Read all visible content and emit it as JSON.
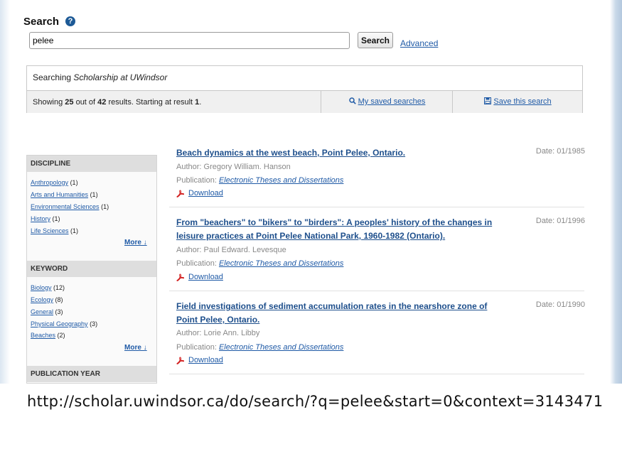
{
  "search": {
    "title": "Search",
    "help_icon": "help-icon",
    "query_value": "pelee",
    "button_label": "Search",
    "advanced_label": "Advanced"
  },
  "scope": {
    "prefix": "Searching ",
    "collection": "Scholarship at UWindsor"
  },
  "status": {
    "showing_label": "Showing ",
    "shown_count": "25",
    "out_of_label": " out of ",
    "total_count": "42",
    "results_label": " results. Starting at result ",
    "start": "1",
    "period": ".",
    "saved_searches_label": "My saved searches",
    "save_search_label": "Save this search",
    "saved_icon": "search-icon",
    "save_icon": "save-icon"
  },
  "sidebar": {
    "discipline": {
      "heading": "DISCIPLINE",
      "items": [
        {
          "label": "Anthropology",
          "count": "(1)"
        },
        {
          "label": "Arts and Humanities",
          "count": "(1)"
        },
        {
          "label": "Environmental Sciences",
          "count": "(1)"
        },
        {
          "label": "History",
          "count": "(1)"
        },
        {
          "label": "Life Sciences",
          "count": "(1)"
        }
      ],
      "more_label": "More ↓"
    },
    "keyword": {
      "heading": "KEYWORD",
      "items": [
        {
          "label": "Biology",
          "count": "(12)"
        },
        {
          "label": "Ecology",
          "count": "(8)"
        },
        {
          "label": "General",
          "count": "(3)"
        },
        {
          "label": "Physical Geography",
          "count": "(3)"
        },
        {
          "label": "Beaches",
          "count": "(2)"
        }
      ],
      "more_label": "More ↓"
    },
    "publication_year": {
      "heading": "PUBLICATION YEAR"
    }
  },
  "results": [
    {
      "title": "Beach dynamics at the west beach, Point Pelee, Ontario.",
      "date": "Date: 01/1985",
      "author_label": "Author: ",
      "author": "Gregory William. Hanson",
      "publication_label": "Publication: ",
      "publication": "Electronic Theses and Dissertations",
      "download_label": "Download"
    },
    {
      "title": "From \"beachers\" to \"bikers\" to \"birders\": A peoples' history of the changes in leisure practices at Point Pelee National Park, 1960-1982 (Ontario).",
      "date": "Date: 01/1996",
      "author_label": "Author: ",
      "author": "Paul Edward. Levesque",
      "publication_label": "Publication: ",
      "publication": "Electronic Theses and Dissertations",
      "download_label": "Download"
    },
    {
      "title": "Field investigations of sediment accumulation rates in the nearshore zone of Point Pelee, Ontario.",
      "date": "Date: 01/1990",
      "author_label": "Author: ",
      "author": "Lorie Ann. Libby",
      "publication_label": "Publication: ",
      "publication": "Electronic Theses and Dissertations",
      "download_label": "Download"
    }
  ],
  "caption": {
    "url": "http://scholar.uwindsor.ca/do/search/?q=pelee&start=0&context=3143471"
  }
}
